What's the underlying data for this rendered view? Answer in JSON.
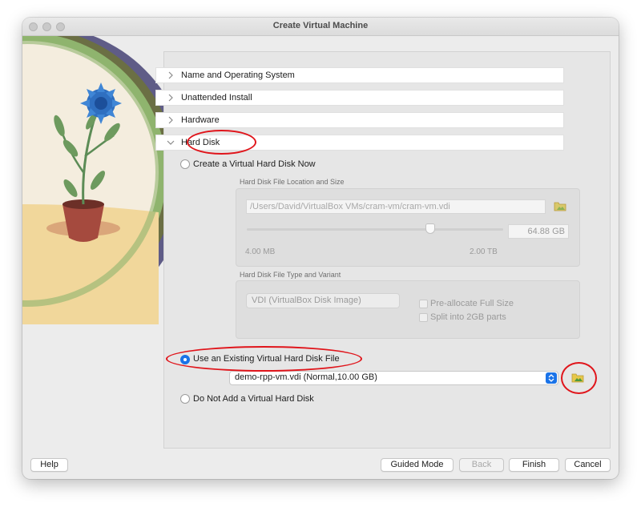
{
  "window": {
    "title": "Create Virtual Machine"
  },
  "sections": [
    {
      "label": "Name and Operating System",
      "expanded": false
    },
    {
      "label": "Unattended Install",
      "expanded": false
    },
    {
      "label": "Hardware",
      "expanded": false
    },
    {
      "label": "Hard Disk",
      "expanded": true
    }
  ],
  "hard_disk": {
    "options": {
      "create": "Create a Virtual Hard Disk Now",
      "existing": "Use an Existing Virtual Hard Disk File",
      "none": "Do Not Add a Virtual Hard Disk"
    },
    "selected_option": "existing",
    "location_group_title": "Hard Disk File Location and Size",
    "location_path": "/Users/David/VirtualBox VMs/cram-vm/cram-vm.vdi",
    "size_value": "64.88 GB",
    "size_min_label": "4.00 MB",
    "size_max_label": "2.00 TB",
    "type_group_title": "Hard Disk File Type and Variant",
    "disk_type": "VDI (VirtualBox Disk Image)",
    "preallocate_label": "Pre-allocate Full Size",
    "split_label": "Split into 2GB parts",
    "existing_file": "demo-rpp-vm.vdi (Normal,10.00 GB)"
  },
  "buttons": {
    "help": "Help",
    "guided_mode": "Guided Mode",
    "back": "Back",
    "finish": "Finish",
    "cancel": "Cancel"
  },
  "icons": {
    "folder": "folder-icon",
    "chevron_right": "chevron-right-icon",
    "chevron_down": "chevron-down-icon"
  },
  "colors": {
    "accent": "#1a73e8",
    "callout": "#e0151b"
  }
}
